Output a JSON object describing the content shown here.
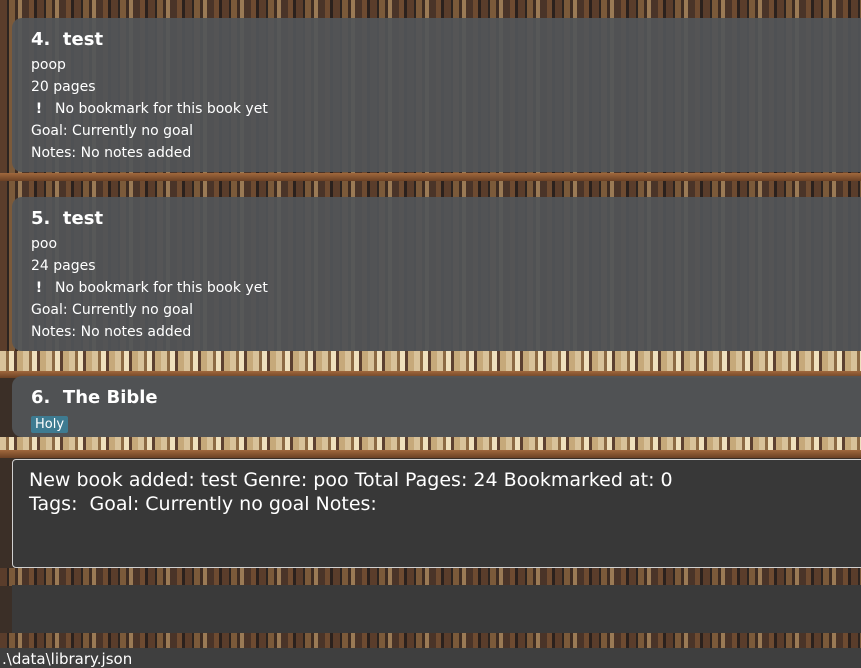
{
  "book_list": [
    {
      "index": "4.",
      "title": "test",
      "genre": "poop",
      "pages": "20 pages",
      "bookmark": "No bookmark for this book yet",
      "goal": "Goal: Currently no goal",
      "notes": "Notes: No notes added"
    },
    {
      "index": "5.",
      "title": "test",
      "genre": "poo",
      "pages": "24 pages",
      "bookmark": "No bookmark for this book yet",
      "goal": "Goal: Currently no goal",
      "notes": "Notes: No notes added"
    },
    {
      "index": "6.",
      "title": "The Bible",
      "tag": "Holy"
    }
  ],
  "bookmark_icon_glyph": "!",
  "result_display": {
    "line1": "New book added: test Genre: poo Total Pages: 24 Bookmarked at: 0",
    "line2": "Tags:  Goal: Currently no goal Notes:"
  },
  "command_box": {
    "value": ""
  },
  "status_bar": {
    "path": ".\\data\\library.json"
  },
  "colors": {
    "card_bg": "#525558",
    "tag_bg": "#3e7b91",
    "result_bg": "#383838",
    "status_bg": "#3f3f3f"
  }
}
